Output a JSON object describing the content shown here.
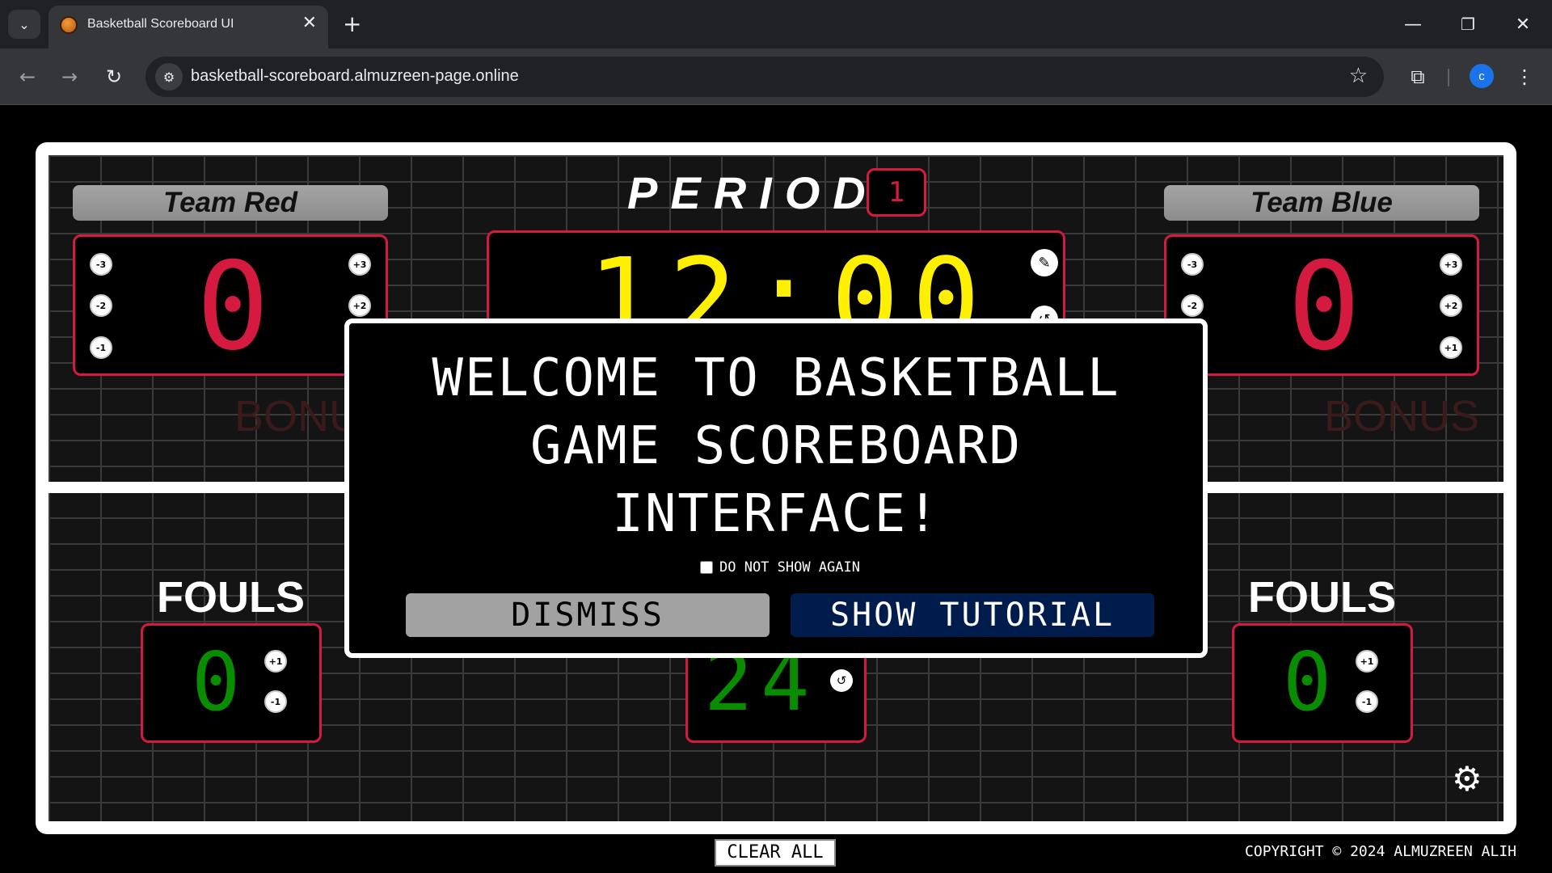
{
  "browser": {
    "tab_title": "Basketball Scoreboard UI",
    "url": "basketball-scoreboard.almuzreen-page.online",
    "avatar_letter": "c",
    "icons": {
      "tab_list": "chevron-down-icon",
      "tab_close": "close-icon",
      "new_tab": "plus-icon",
      "minimize": "minimize-icon",
      "restore": "restore-icon",
      "close_window": "close-icon",
      "back": "back-arrow-icon",
      "forward": "forward-arrow-icon",
      "reload": "reload-icon",
      "site_info": "tune-icon",
      "bookmark": "star-icon",
      "extensions": "puzzle-icon",
      "menu": "kebab-menu-icon"
    }
  },
  "scoreboard": {
    "period_label": "PERIOD",
    "period_value": "1",
    "clock": "12:00",
    "shot_clock": "24",
    "bonus_label": "BONUS",
    "fouls_label": "FOULS",
    "home": {
      "name": "Team Red",
      "score": "0",
      "fouls": "0",
      "minus": [
        "-3",
        "-2",
        "-1"
      ],
      "plus": [
        "+3",
        "+2"
      ]
    },
    "away": {
      "name": "Team Blue",
      "score": "0",
      "fouls": "0",
      "minus": [
        "-3",
        "-2"
      ],
      "plus": [
        "+3",
        "+2",
        "+1"
      ]
    },
    "foul_buttons": [
      "+1",
      "-1"
    ],
    "clear_all_label": "CLEAR ALL",
    "copyright": "COPYRIGHT © 2024 ALMUZREEN ALIH",
    "colors": {
      "accent_red": "#d51a3f",
      "clock_yellow": "#ffef00",
      "shot_clock_green": "#0a8c00",
      "tutorial_blue": "#001c4d"
    }
  },
  "modal": {
    "title": "WELCOME TO BASKETBALL GAME SCOREBOARD INTERFACE!",
    "checkbox_label": "DO NOT SHOW AGAIN",
    "checkbox_checked": false,
    "dismiss_label": "DISMISS",
    "tutorial_label": "SHOW TUTORIAL"
  }
}
